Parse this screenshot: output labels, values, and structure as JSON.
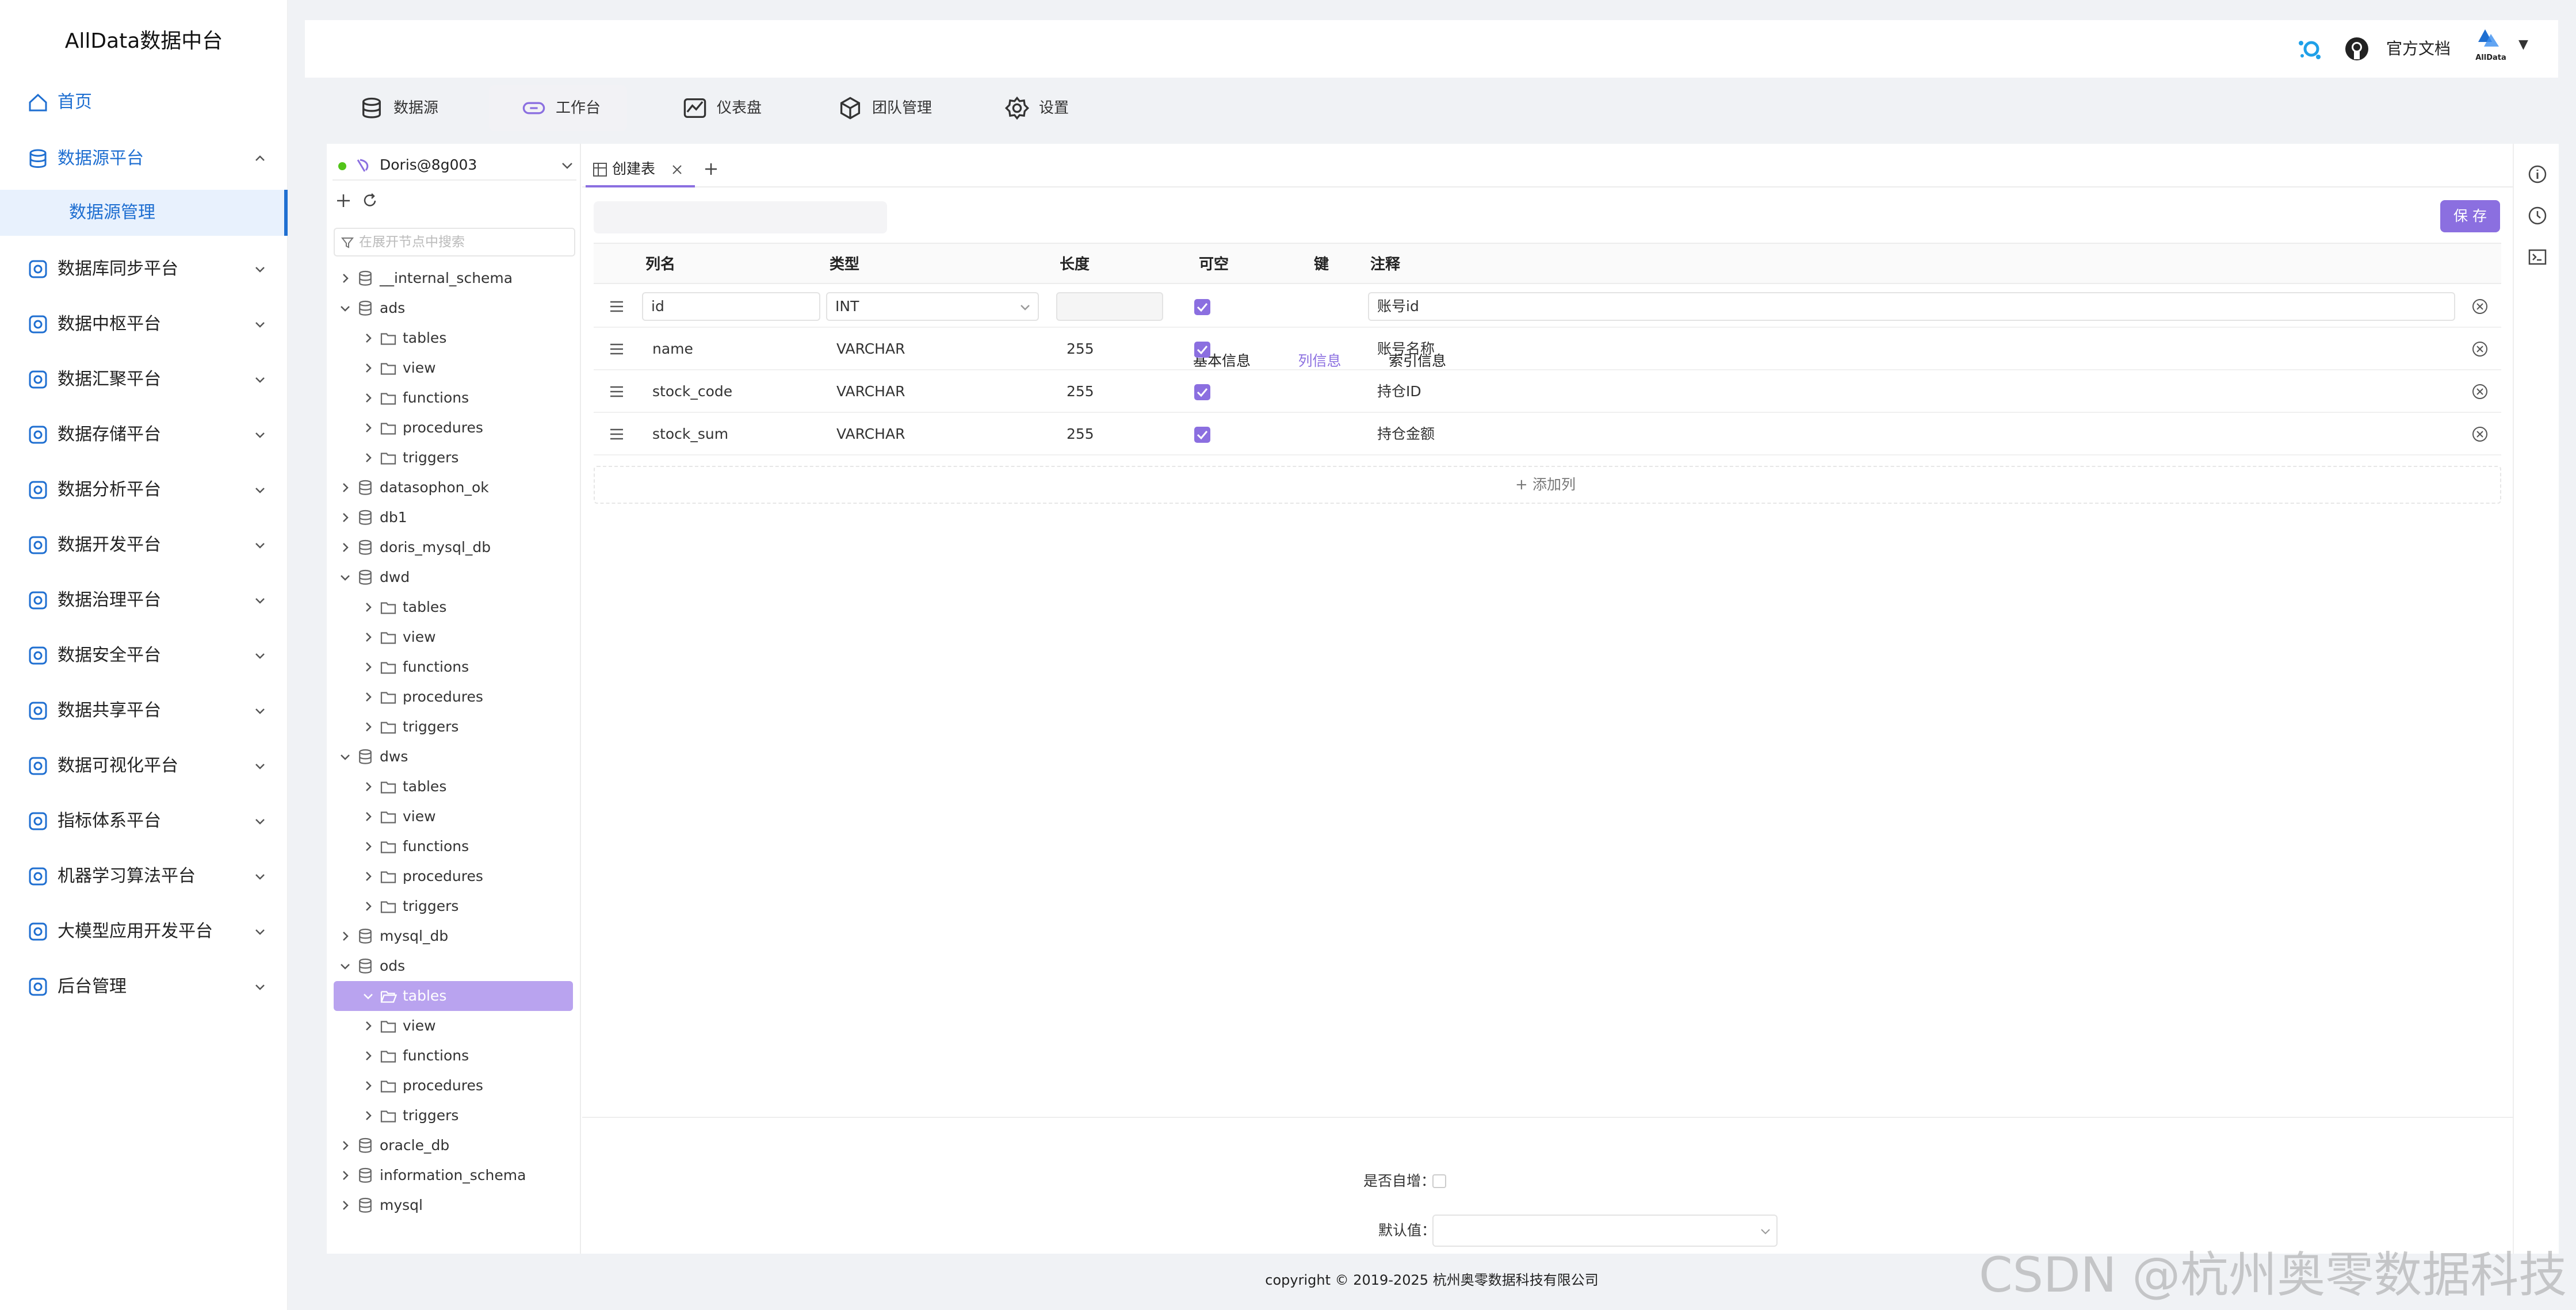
{
  "app_title": "AllData数据中台",
  "sidebar": {
    "items": [
      {
        "label": "首页",
        "icon": "home-icon"
      },
      {
        "label": "数据源平台",
        "icon": "database-icon",
        "expanded": true
      },
      {
        "label": "数据库同步平台",
        "icon": "sync-icon"
      },
      {
        "label": "数据中枢平台",
        "icon": "hub-icon"
      },
      {
        "label": "数据汇聚平台",
        "icon": "layers-icon"
      },
      {
        "label": "数据存储平台",
        "icon": "storage-icon"
      },
      {
        "label": "数据分析平台",
        "icon": "analysis-icon"
      },
      {
        "label": "数据开发平台",
        "icon": "dev-icon"
      },
      {
        "label": "数据治理平台",
        "icon": "governance-icon"
      },
      {
        "label": "数据安全平台",
        "icon": "security-icon"
      },
      {
        "label": "数据共享平台",
        "icon": "share-icon"
      },
      {
        "label": "数据可视化平台",
        "icon": "visual-icon"
      },
      {
        "label": "指标体系平台",
        "icon": "metric-icon"
      },
      {
        "label": "机器学习算法平台",
        "icon": "ml-icon"
      },
      {
        "label": "大模型应用开发平台",
        "icon": "llm-icon"
      },
      {
        "label": "后台管理",
        "icon": "admin-icon"
      }
    ],
    "sub_item": "数据源管理"
  },
  "header": {
    "docs_label": "官方文档",
    "logo_text": "AllData"
  },
  "top_tabs": [
    {
      "label": "数据源",
      "icon": "database-icon"
    },
    {
      "label": "工作台",
      "icon": "link-icon",
      "active": true
    },
    {
      "label": "仪表盘",
      "icon": "chart-icon"
    },
    {
      "label": "团队管理",
      "icon": "cube-icon"
    },
    {
      "label": "设置",
      "icon": "gear-icon"
    }
  ],
  "connection": {
    "name": "Doris@8g003"
  },
  "tree": {
    "search_placeholder": "在展开节点中搜索",
    "nodes": [
      {
        "label": "__internal_schema",
        "level": 0,
        "type": "db",
        "expanded": false
      },
      {
        "label": "ads",
        "level": 0,
        "type": "db",
        "expanded": true
      },
      {
        "label": "tables",
        "level": 1,
        "type": "folder"
      },
      {
        "label": "view",
        "level": 1,
        "type": "folder"
      },
      {
        "label": "functions",
        "level": 1,
        "type": "folder"
      },
      {
        "label": "procedures",
        "level": 1,
        "type": "folder"
      },
      {
        "label": "triggers",
        "level": 1,
        "type": "folder"
      },
      {
        "label": "datasophon_ok",
        "level": 0,
        "type": "db",
        "expanded": false
      },
      {
        "label": "db1",
        "level": 0,
        "type": "db",
        "expanded": false
      },
      {
        "label": "doris_mysql_db",
        "level": 0,
        "type": "db",
        "expanded": false
      },
      {
        "label": "dwd",
        "level": 0,
        "type": "db",
        "expanded": true
      },
      {
        "label": "tables",
        "level": 1,
        "type": "folder"
      },
      {
        "label": "view",
        "level": 1,
        "type": "folder"
      },
      {
        "label": "functions",
        "level": 1,
        "type": "folder"
      },
      {
        "label": "procedures",
        "level": 1,
        "type": "folder"
      },
      {
        "label": "triggers",
        "level": 1,
        "type": "folder"
      },
      {
        "label": "dws",
        "level": 0,
        "type": "db",
        "expanded": true
      },
      {
        "label": "tables",
        "level": 1,
        "type": "folder"
      },
      {
        "label": "view",
        "level": 1,
        "type": "folder"
      },
      {
        "label": "functions",
        "level": 1,
        "type": "folder"
      },
      {
        "label": "procedures",
        "level": 1,
        "type": "folder"
      },
      {
        "label": "triggers",
        "level": 1,
        "type": "folder"
      },
      {
        "label": "mysql_db",
        "level": 0,
        "type": "db",
        "expanded": false
      },
      {
        "label": "ods",
        "level": 0,
        "type": "db",
        "expanded": true
      },
      {
        "label": "tables",
        "level": 1,
        "type": "folder-open",
        "selected": true
      },
      {
        "label": "view",
        "level": 1,
        "type": "folder"
      },
      {
        "label": "functions",
        "level": 1,
        "type": "folder"
      },
      {
        "label": "procedures",
        "level": 1,
        "type": "folder"
      },
      {
        "label": "triggers",
        "level": 1,
        "type": "folder"
      },
      {
        "label": "oracle_db",
        "level": 0,
        "type": "db",
        "expanded": false
      },
      {
        "label": "information_schema",
        "level": 0,
        "type": "db",
        "expanded": false
      },
      {
        "label": "mysql",
        "level": 0,
        "type": "db",
        "expanded": false
      }
    ]
  },
  "editor": {
    "tab_label": "创建表",
    "subtabs": [
      "基本信息",
      "列信息",
      "索引信息"
    ],
    "active_subtab": 1,
    "save_label": "保 存",
    "columns_header": [
      "列名",
      "类型",
      "长度",
      "可空",
      "键",
      "注释"
    ],
    "rows": [
      {
        "name": "id",
        "type": "INT",
        "length": "",
        "nullable": true,
        "comment": "账号id",
        "editing": true
      },
      {
        "name": "name",
        "type": "VARCHAR",
        "length": "255",
        "nullable": true,
        "comment": "账号名称"
      },
      {
        "name": "stock_code",
        "type": "VARCHAR",
        "length": "255",
        "nullable": true,
        "comment": "持仓ID"
      },
      {
        "name": "stock_sum",
        "type": "VARCHAR",
        "length": "255",
        "nullable": true,
        "comment": "持仓金额"
      }
    ],
    "add_column_label": "添加列",
    "auto_increment_label": "是否自增：",
    "default_value_label": "默认值："
  },
  "footer": {
    "copyright": "copyright © 2019-2025 杭州奥零数据科技有限公司"
  },
  "watermark": "CSDN @杭州奥零数据科技",
  "colors": {
    "accent": "#8b6fe0",
    "sidebar_active": "#1f6fd1",
    "selected_node": "#b9a3ef"
  }
}
